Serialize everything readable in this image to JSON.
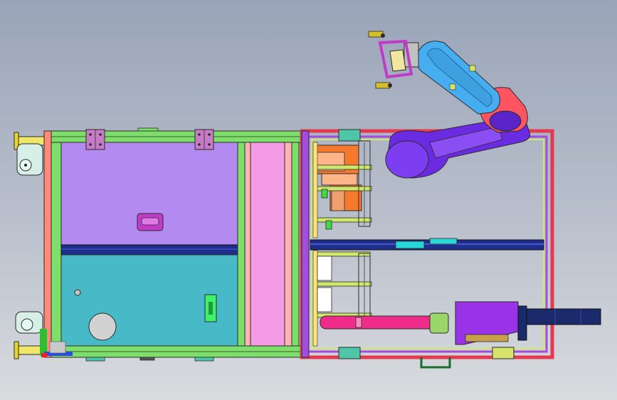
{
  "viewport": {
    "background_top": "#9aa4b8",
    "background_bottom": "#d9dcdf"
  },
  "colors": {
    "frame_green": "#7ddf6a",
    "frame_red": "#e4394f",
    "frame_purple": "#a44be0",
    "panel_lavender": "#b28af0",
    "panel_teal": "#48b9c6",
    "panel_pink": "#f59be6",
    "robot_blue": "#46aef0",
    "robot_red": "#ff5560",
    "robot_purple": "#6b2be0",
    "cylinder_magenta": "#f02c8a",
    "motor_purple": "#9a32e8",
    "motor_navy": "#1a2a6a",
    "feeder_orange": "#f57a2d",
    "divider_navy": "#1f2d8c"
  },
  "icons": {
    "caster_wheel": "caster-wheel-icon",
    "axis_triad": "axis-triad-icon",
    "handle": "handle-icon"
  }
}
